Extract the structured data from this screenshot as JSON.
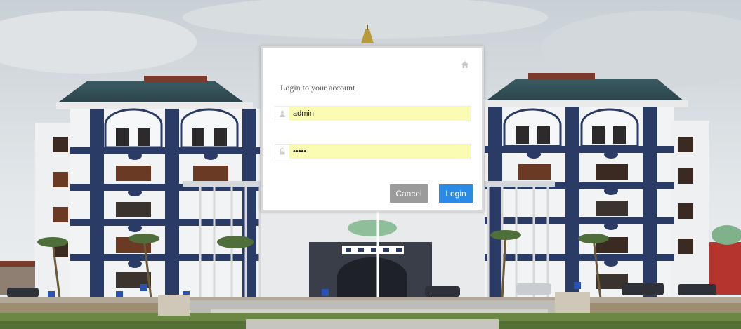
{
  "login": {
    "heading": "Login to your account",
    "username_value": "admin",
    "password_value": "•••••",
    "cancel_label": "Cancel",
    "login_label": "Login"
  },
  "icons": {
    "home": "home-icon",
    "user": "user-icon",
    "lock": "lock-icon"
  },
  "colors": {
    "login_button": "#2a8be6",
    "cancel_button": "#9b9b9b",
    "input_fill": "#fbfcb4"
  }
}
